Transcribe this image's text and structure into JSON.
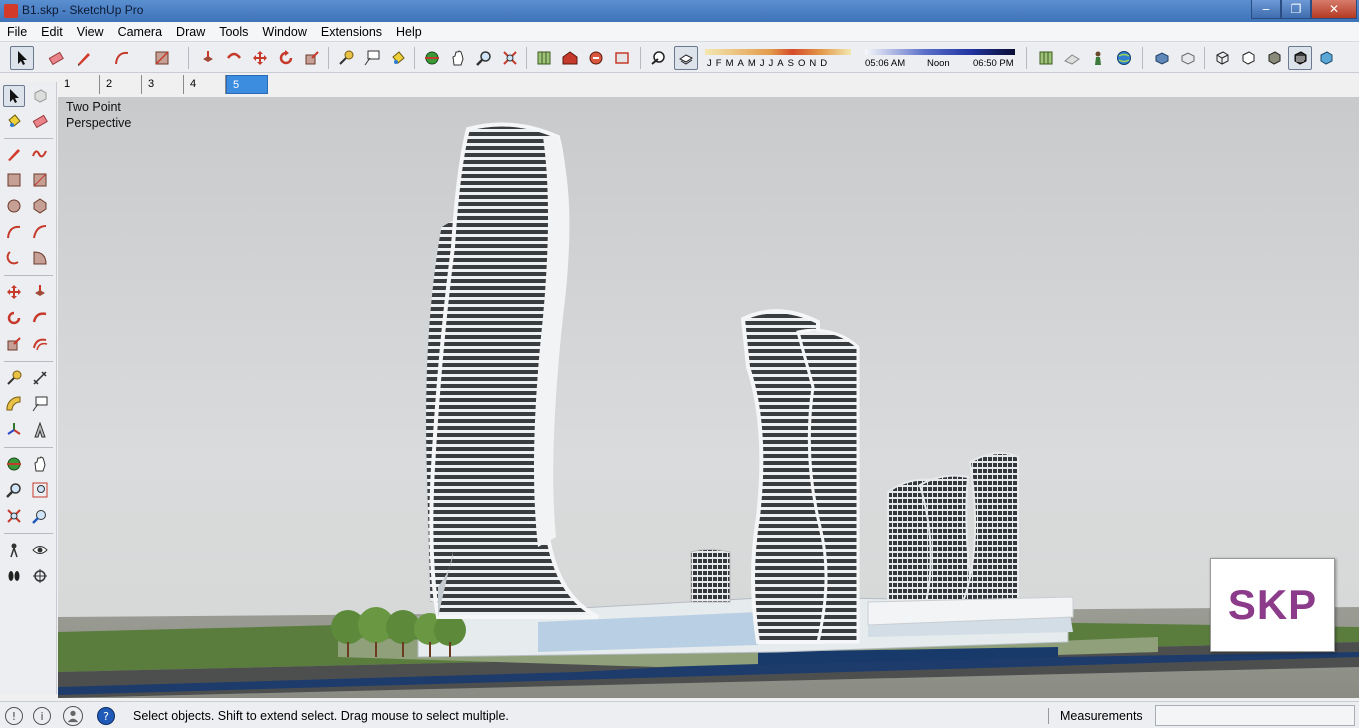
{
  "window": {
    "title": "B1.skp - SketchUp Pro",
    "minimize": "‒",
    "maximize": "❐",
    "close": "✕"
  },
  "menu": [
    "File",
    "Edit",
    "View",
    "Camera",
    "Draw",
    "Tools",
    "Window",
    "Extensions",
    "Help"
  ],
  "toolbar": {
    "shadow_months": [
      "J",
      "F",
      "M",
      "A",
      "M",
      "J",
      "J",
      "A",
      "S",
      "O",
      "N",
      "D"
    ],
    "time_start": "05:06 AM",
    "time_noon": "Noon",
    "time_end": "06:50 PM"
  },
  "scenes": [
    "1",
    "2",
    "3",
    "4",
    "5"
  ],
  "active_scene": "5",
  "viewport": {
    "label_line1": "Two Point",
    "label_line2": "Perspective",
    "badge": "SKP"
  },
  "status": {
    "message": "Select objects. Shift to extend select. Drag mouse to select multiple.",
    "measurements_label": "Measurements",
    "measurements_value": ""
  },
  "colors": {
    "accent": "#3c8de0",
    "badge_text": "#8c3a8a"
  }
}
